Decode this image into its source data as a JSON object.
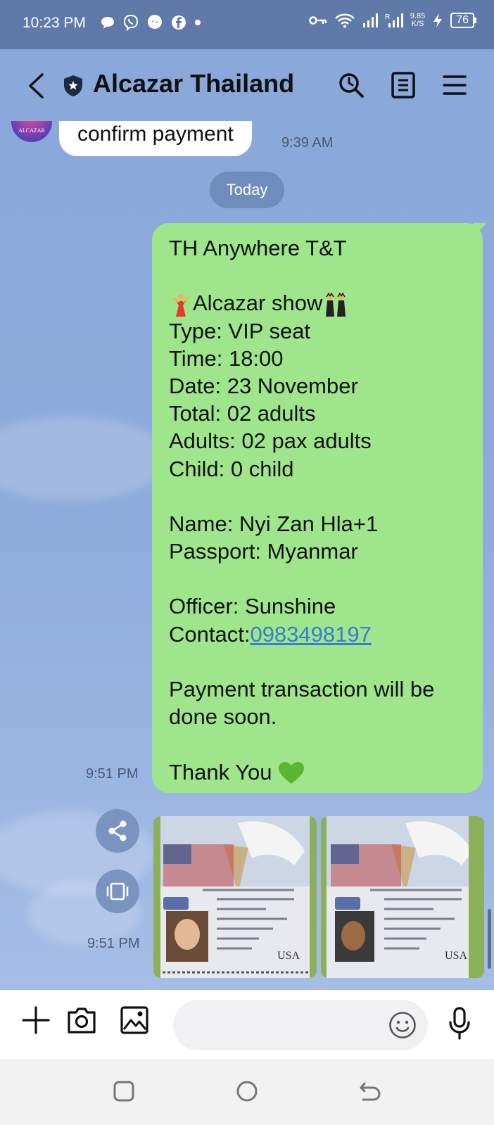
{
  "status_bar": {
    "time": "10:23 PM",
    "net_speed_top": "9.85",
    "net_speed_bottom": "K/S",
    "battery": "76",
    "icons": [
      "chat-bubble-icon",
      "viber-icon",
      "messenger-icon",
      "facebook-icon",
      "dot-icon",
      "key-icon",
      "wifi-icon",
      "signal-icon",
      "signal-r-icon",
      "charging-icon"
    ]
  },
  "header": {
    "title": "Alcazar Thailand",
    "icons": [
      "back-icon",
      "shield-icon",
      "search-icon",
      "notes-icon",
      "menu-icon"
    ]
  },
  "chat": {
    "incoming": {
      "avatar_text": "ALCAZAR",
      "text": "confirm payment",
      "time": "9:39 AM"
    },
    "date_separator": "Today",
    "outgoing_text": {
      "lines": [
        "TH Anywhere T&T",
        "",
        "Alcazar show",
        "Type: VIP seat",
        "Time: 18:00",
        "Date: 23 November",
        "Total: 02 adults",
        "Adults: 02 pax adults",
        "Child: 0 child",
        "",
        "Name: Nyi Zan Hla+1",
        "Passport:  Myanmar",
        "",
        "Officer: Sunshine",
        "Contact:",
        "Payment transaction will be",
        "done soon.",
        "",
        "Thank You"
      ],
      "contact_link": "0983498197",
      "time": "9:51 PM"
    },
    "outgoing_photos": {
      "count": 2,
      "time": "9:51 PM",
      "photo_texts": [
        "USA",
        "USA"
      ]
    }
  },
  "input_bar": {
    "placeholder": "",
    "icons": [
      "plus-icon",
      "camera-icon",
      "image-icon",
      "emoji-icon",
      "mic-icon"
    ]
  },
  "nav_bar": {
    "icons": [
      "recents-icon",
      "home-icon",
      "back-nav-icon"
    ]
  }
}
